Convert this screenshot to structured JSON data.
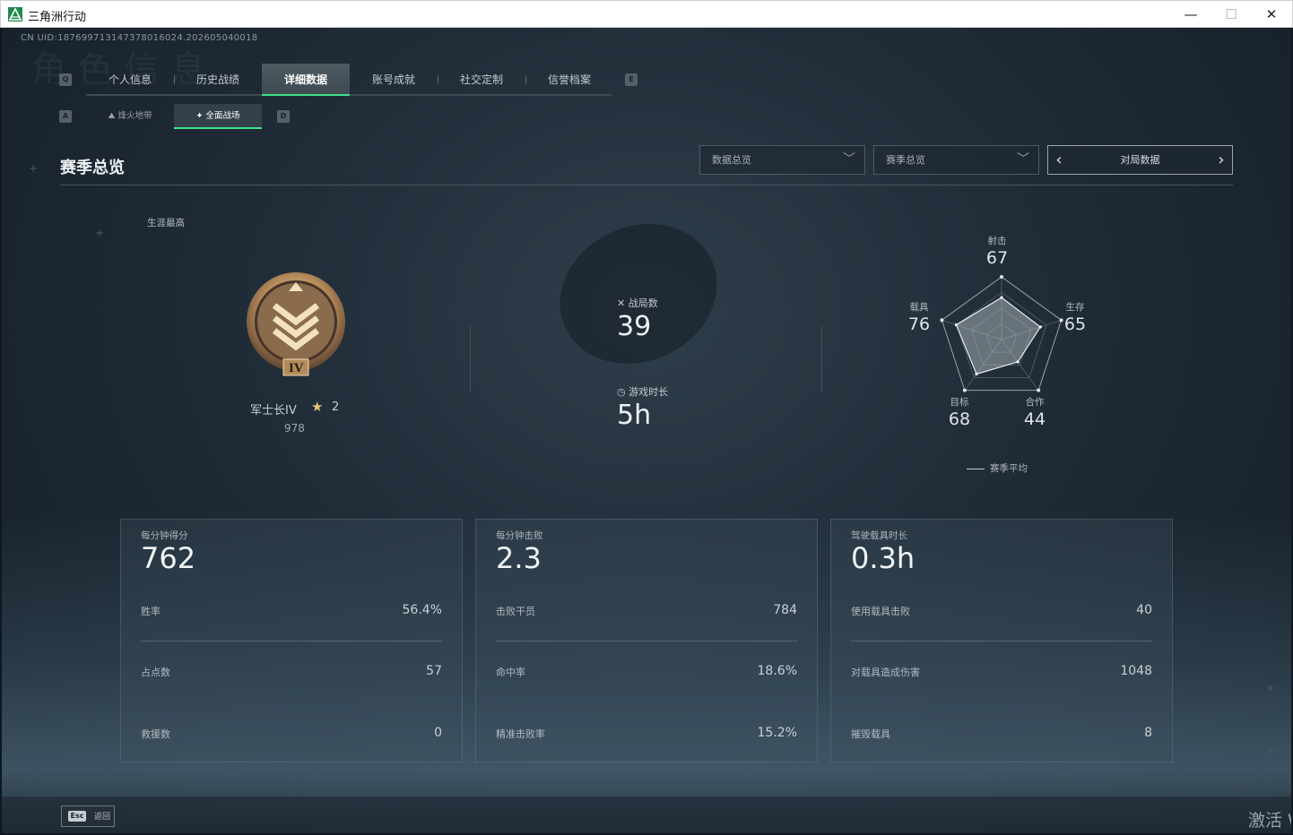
{
  "window": {
    "title": "三角洲行动",
    "minimize": "—",
    "maximize": "☐",
    "close": "✕"
  },
  "uid": "CN UID:187699713147378016024.202605040018",
  "ghost_text": "角色信息",
  "tabs": {
    "prev_key": "Q",
    "next_key": "E",
    "items": [
      {
        "label": "个人信息"
      },
      {
        "label": "历史战绩"
      },
      {
        "label": "详细数据",
        "active": true
      },
      {
        "label": "账号成就"
      },
      {
        "label": "社交定制"
      },
      {
        "label": "信誉档案"
      }
    ]
  },
  "subtabs": {
    "prev_key": "A",
    "next_key": "D",
    "items": [
      {
        "label": "烽火地带",
        "icon": "mountain-icon"
      },
      {
        "label": "全面战场",
        "icon": "crosshair-icon",
        "active": true
      }
    ]
  },
  "section_title": "赛季总览",
  "filters": {
    "data_view": "数据总览",
    "season_view": "赛季总览",
    "pager_label": "对局数据"
  },
  "rank": {
    "career_label": "生涯最高",
    "badge_numeral": "IV",
    "name": "军士长IV",
    "stars": "2",
    "points": "978"
  },
  "matches": {
    "label": "战局数",
    "value": "39",
    "icon": "crossed-swords-icon"
  },
  "playtime": {
    "label": "游戏时长",
    "value": "5h",
    "icon": "clock-icon"
  },
  "radar": {
    "legend": "赛季平均",
    "axes": [
      {
        "label": "射击",
        "value": 67
      },
      {
        "label": "生存",
        "value": 65
      },
      {
        "label": "合作",
        "value": 44
      },
      {
        "label": "目标",
        "value": 68
      },
      {
        "label": "载具",
        "value": 76
      }
    ]
  },
  "cards": [
    {
      "head_label": "每分钟得分",
      "head_value": "762",
      "rows": [
        {
          "label": "胜率",
          "value": "56.4%"
        },
        {
          "label": "占点数",
          "value": "57"
        },
        {
          "label": "救援数",
          "value": "0"
        }
      ]
    },
    {
      "head_label": "每分钟击败",
      "head_value": "2.3",
      "rows": [
        {
          "label": "击败干员",
          "value": "784"
        },
        {
          "label": "命中率",
          "value": "18.6%"
        },
        {
          "label": "精准击败率",
          "value": "15.2%"
        }
      ]
    },
    {
      "head_label": "驾驶载具时长",
      "head_value": "0.3h",
      "rows": [
        {
          "label": "使用载具击败",
          "value": "40"
        },
        {
          "label": "对载具造成伤害",
          "value": "1048"
        },
        {
          "label": "摧毁载具",
          "value": "8"
        }
      ]
    }
  ],
  "footer": {
    "esc_key": "Esc",
    "back_label": "返回",
    "watermark": "激活 W"
  },
  "colors": {
    "accent": "#3fe08a",
    "background": "#1f2b37",
    "rank_gold": "#e3c47a"
  }
}
